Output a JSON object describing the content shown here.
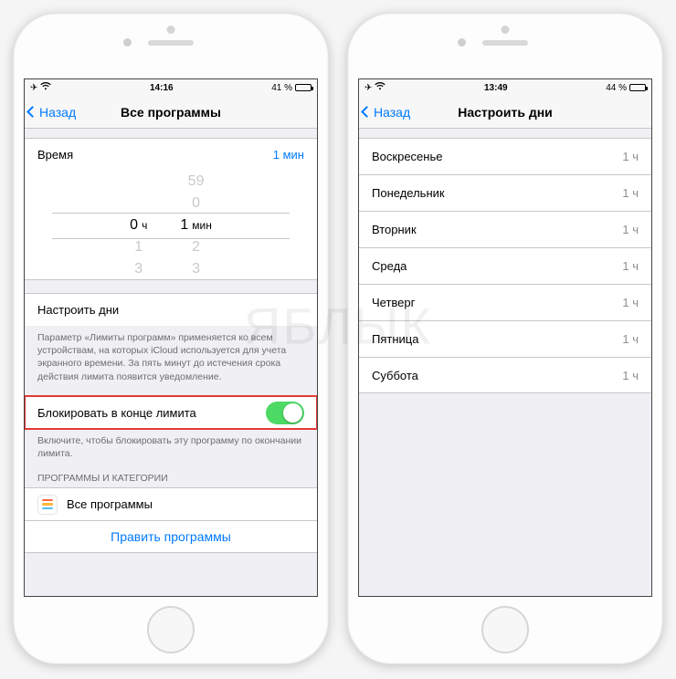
{
  "left": {
    "status": {
      "time": "14:16",
      "battery_pct": "41 %",
      "battery_fill_pct": 41
    },
    "nav": {
      "back": "Назад",
      "title": "Все программы"
    },
    "time_row": {
      "label": "Время",
      "value": "1 мин"
    },
    "picker": {
      "hours_sel": "0",
      "hours_unit": "ч",
      "mins_sel": "1",
      "mins_unit": "мин",
      "h_below1": "1",
      "h_below2": "3",
      "m_above2": "59",
      "m_above1": "0",
      "m_below1": "2",
      "m_below2": "3"
    },
    "customize_days": "Настроить дни",
    "limits_footer": "Параметр «Лимиты программ» применяется ко всем устройствам, на которых iCloud используется для учета экранного времени. За пять минут до истечения срока действия лимита появится уведомление.",
    "block_row": {
      "label": "Блокировать в конце лимита",
      "on": true
    },
    "block_footer": "Включите, чтобы блокировать эту программу по окончании лимита.",
    "apps_header": "ПРОГРАММЫ И КАТЕГОРИИ",
    "all_apps": "Все программы",
    "edit_apps": "Править программы"
  },
  "right": {
    "status": {
      "time": "13:49",
      "battery_pct": "44 %",
      "battery_fill_pct": 44
    },
    "nav": {
      "back": "Назад",
      "title": "Настроить дни"
    },
    "value": "1 ч",
    "days": [
      {
        "name": "Воскресенье"
      },
      {
        "name": "Понедельник"
      },
      {
        "name": "Вторник"
      },
      {
        "name": "Среда"
      },
      {
        "name": "Четверг"
      },
      {
        "name": "Пятница"
      },
      {
        "name": "Суббота"
      }
    ]
  }
}
